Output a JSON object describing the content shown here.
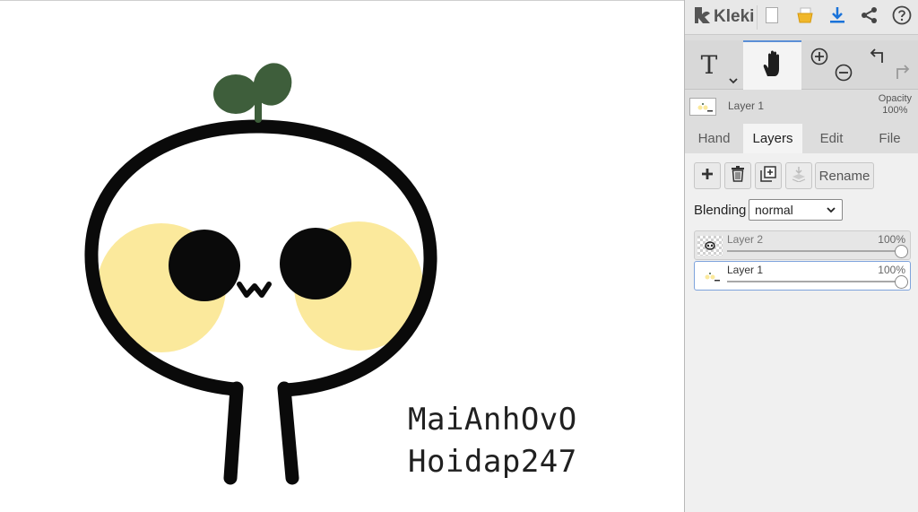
{
  "app": {
    "name": "Kleki"
  },
  "canvas": {
    "text_lines": [
      "MaiAnhOvO",
      "Hoidap247"
    ],
    "colors": {
      "stroke": "#0a0a0a",
      "blush": "#fbe99c",
      "leaf": "#3e5e3b",
      "background": "#ffffff"
    }
  },
  "topbar": {
    "icons": [
      "kleki-logo-icon",
      "new-image-icon",
      "open-folder-icon",
      "download-icon",
      "share-icon",
      "help-icon"
    ]
  },
  "tools": {
    "text_tool_label": "T",
    "icons": [
      "text-tool-icon",
      "hand-tool-icon",
      "zoom-in-icon",
      "zoom-out-icon",
      "undo-icon",
      "redo-icon"
    ]
  },
  "current_layer": {
    "name": "Layer 1",
    "opacity_label": "Opacity",
    "opacity_value": "100%"
  },
  "tabs": [
    {
      "label": "Hand"
    },
    {
      "label": "Layers"
    },
    {
      "label": "Edit"
    },
    {
      "label": "File"
    }
  ],
  "layers_panel": {
    "rename_label": "Rename",
    "blending_label": "Blending",
    "blending_value": "normal",
    "layers": [
      {
        "name": "Layer 2",
        "opacity": "100%",
        "opacity_fraction": 1.0
      },
      {
        "name": "Layer 1",
        "opacity": "100%",
        "opacity_fraction": 1.0
      }
    ]
  },
  "colors": {
    "accent": "#1a73d9",
    "folder": "#f0b72a",
    "active_border": "#5b8fd6"
  }
}
